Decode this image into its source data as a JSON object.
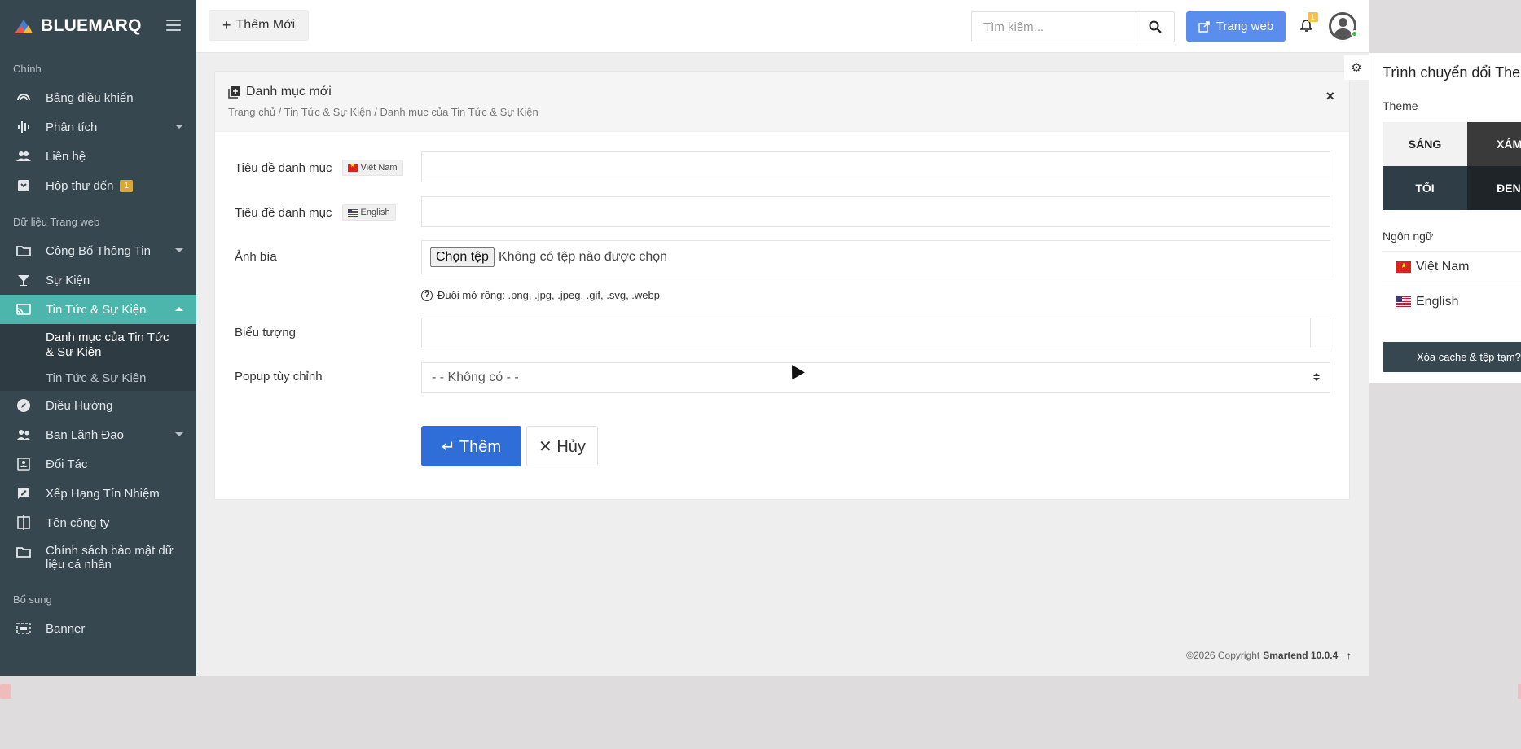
{
  "brand": {
    "name": "BLUEMARQ"
  },
  "sidebar": {
    "sections": {
      "main": "Chính",
      "website_data": "Dữ liệu Trang web",
      "extra": "Bổ sung"
    },
    "items": {
      "dashboard": "Bảng điều khiển",
      "analytics": "Phân tích",
      "contacts": "Liên hệ",
      "inbox": "Hộp thư đến",
      "inbox_badge": "1",
      "announcements": "Công Bố Thông Tin",
      "events": "Sự Kiện",
      "news": "Tin Tức & Sự Kiện",
      "news_categories": "Danh mục của Tin Tức & Sự Kiện",
      "news_list": "Tin Tức & Sự Kiện",
      "navigation": "Điều Hướng",
      "leadership": "Ban Lãnh Đạo",
      "partners": "Đối Tác",
      "credit_rating": "Xếp Hạng Tín Nhiệm",
      "company_name": "Tên công ty",
      "privacy": "Chính sách bảo mật dữ liệu cá nhân",
      "banner": "Banner"
    }
  },
  "topbar": {
    "add_new": "Thêm Mới",
    "search_placeholder": "Tìm kiếm...",
    "website_button": "Trang web",
    "notification_count": "1"
  },
  "form": {
    "title": "Danh mục mới",
    "breadcrumb": "Trang chủ / Tin Tức & Sự Kiện / Danh mục của Tin Tức & Sự Kiện",
    "close": "×",
    "category_title_label": "Tiêu đề danh mục",
    "lang_vi": "Việt Nam",
    "lang_en": "English",
    "cover_label": "Ảnh bìa",
    "file_button": "Chọn tệp",
    "file_status": "Không có tệp nào được chọn",
    "extensions_hint": "Đuôi mở rộng: .png, .jpg, .jpeg, .gif, .svg, .webp",
    "icon_label": "Biểu tượng",
    "popup_label": "Popup tùy chỉnh",
    "popup_value": "- - Không có - -",
    "submit": "↵ Thêm",
    "cancel": "✕ Hủy"
  },
  "footer": {
    "copyright": "©2026 Copyright",
    "product": "Smartend 10.0.4"
  },
  "theme_panel": {
    "title": "Trình chuyển đổi Theme",
    "theme_label": "Theme",
    "light": "SÁNG",
    "gray": "XÁM",
    "dark": "TỐI",
    "black": "ĐEN",
    "language_label": "Ngôn ngữ",
    "lang_vi": "Việt Nam",
    "lang_en": "English",
    "clear_cache": "Xóa cache & tệp tạm?"
  },
  "colors": {
    "sidebar_bg": "#37474f",
    "active_item": "#4db6ac",
    "primary_button": "#2f6ed8",
    "website_button": "#5b8def"
  }
}
